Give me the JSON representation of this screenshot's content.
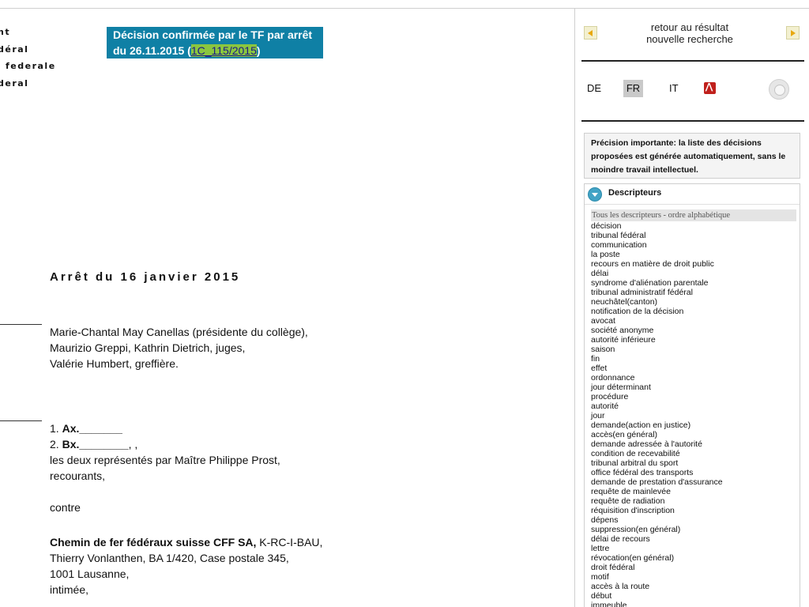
{
  "doc": {
    "court_lines": [
      "ht",
      "déral",
      "federale",
      "deral"
    ],
    "banner_text": "Décision confirmée par le TF par arrêt du 26.11.2015 (",
    "banner_link": "1C_115/2015",
    "banner_end": ")",
    "title": "Arrêt du 16 janvier 2015",
    "composition": [
      "Marie-Chantal May Canellas (présidente du collège),",
      "Maurizio Greppi, Kathrin Dietrich, juges,",
      "Valérie Humbert, greffière."
    ],
    "party1_num": "1. ",
    "party1_name": "Ax._______",
    "party2_num": "2. ",
    "party2_name": "Bx.________",
    "party2_rest": ", ,",
    "represented": "les deux représentés par Maître Philippe Prost,",
    "recourants": "recourants,",
    "contre": "contre",
    "intimee_name": "Chemin de fer fédéraux suisse CFF SA,",
    "intimee_code": " K-RC-I-BAU,",
    "intimee_addr1": "Thierry Vonlanthen, BA 1/420, Case postale 345,",
    "intimee_addr2": "1001 Lausanne,",
    "intimee_role": "intimée,"
  },
  "side": {
    "back_link": "retour au résultat",
    "new_search": "nouvelle recherche",
    "langs": [
      "DE",
      "FR",
      "IT"
    ],
    "active_lang": "FR",
    "notice": "Précision importante: la liste des décisions proposées est générée automatiquement, sans le moindre travail intellectuel.",
    "descriptors_title": "Descripteurs",
    "descriptors_sub": "Tous les descripteurs - ordre alphabétique",
    "descriptors": [
      "décision",
      "tribunal fédéral",
      "communication",
      "la poste",
      "recours en matière de droit public",
      "délai",
      "syndrome d'aliénation parentale",
      "tribunal administratif fédéral",
      "neuchâtel(canton)",
      "notification de la décision",
      "avocat",
      "société anonyme",
      "autorité inférieure",
      "saison",
      "fin",
      "effet",
      "ordonnance",
      "jour déterminant",
      "procédure",
      "autorité",
      "jour",
      "demande(action en justice)",
      "accès(en général)",
      "demande adressée à l'autorité",
      "condition de recevabilité",
      "tribunal arbitral du sport",
      "office fédéral des transports",
      "demande de prestation d'assurance",
      "requête de mainlevée",
      "requête de radiation",
      "réquisition d'inscription",
      "dépens",
      "suppression(en général)",
      "délai de recours",
      "lettre",
      "révocation(en général)",
      "droit fédéral",
      "motif",
      "accès à la route",
      "début",
      "immeuble"
    ]
  }
}
